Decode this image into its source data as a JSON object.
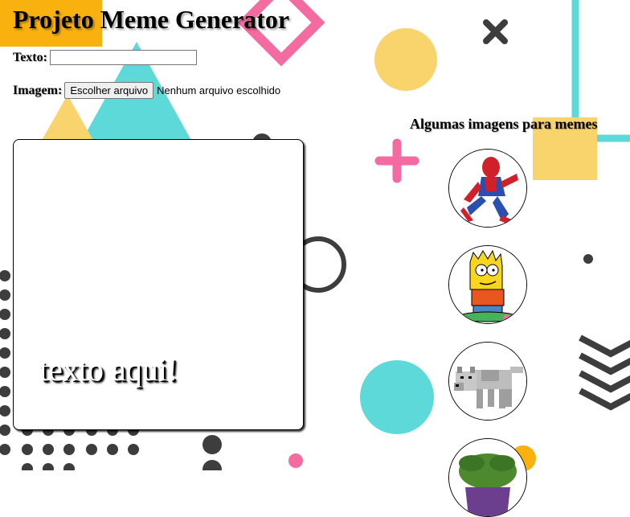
{
  "app": {
    "title": "Projeto Meme Generator"
  },
  "form": {
    "text_label": "Texto:",
    "text_value": "",
    "image_label": "Imagem:",
    "file_button_label": "Escolher arquivo",
    "file_status": "Nenhum arquivo escolhido"
  },
  "meme": {
    "caption": "texto aqui!"
  },
  "gallery": {
    "title": "Algumas imagens para memes",
    "items": [
      {
        "name": "spider-man-image"
      },
      {
        "name": "bart-simpson-image"
      },
      {
        "name": "minecraft-wolf-image"
      },
      {
        "name": "hulk-image"
      }
    ]
  },
  "colors": {
    "title_box": "#f8b10f",
    "cyan": "#5ed9d9",
    "pink": "#f46ba1",
    "yellow": "#f9d36c",
    "dark": "#3d3d3d"
  }
}
